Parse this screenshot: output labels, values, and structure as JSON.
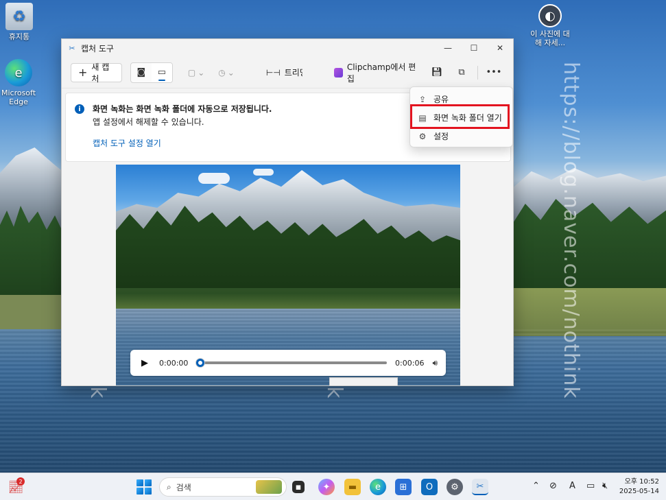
{
  "desktop": {
    "icons": [
      {
        "label": "휴지통"
      },
      {
        "label": "Microsoft Edge"
      },
      {
        "label": "이 사진에 대해 자세..."
      }
    ],
    "watermark": "https://blog.naver.com/nothink"
  },
  "window": {
    "title": "캡처 도구",
    "toolbar": {
      "new_capture": "새 캡처",
      "text_action": "트리밍",
      "clipchamp": "Clipchamp에서 편집"
    },
    "info": {
      "title": "화면 녹화는 화면 녹화 폴더에 자동으로 저장됩니다.",
      "subtitle": "앱 설정에서 해제할 수 있습니다.",
      "link": "캡처 도구 설정 열기"
    },
    "player": {
      "current_time": "0:00:00",
      "total_time": "0:00:06",
      "progress": 0
    },
    "menu": {
      "items": [
        {
          "label": "공유",
          "icon": "share-icon"
        },
        {
          "label": "화면 녹화 폴더 열기",
          "icon": "folder-icon"
        },
        {
          "label": "설정",
          "icon": "gear-icon"
        }
      ]
    }
  },
  "taskbar": {
    "search_placeholder": "검색",
    "badge_count": "2",
    "clock_time": "오후 10:52",
    "clock_date": "2025-05-14",
    "ime": "A"
  },
  "colors": {
    "accent": "#005fb8",
    "highlight_box": "#e3131f"
  }
}
